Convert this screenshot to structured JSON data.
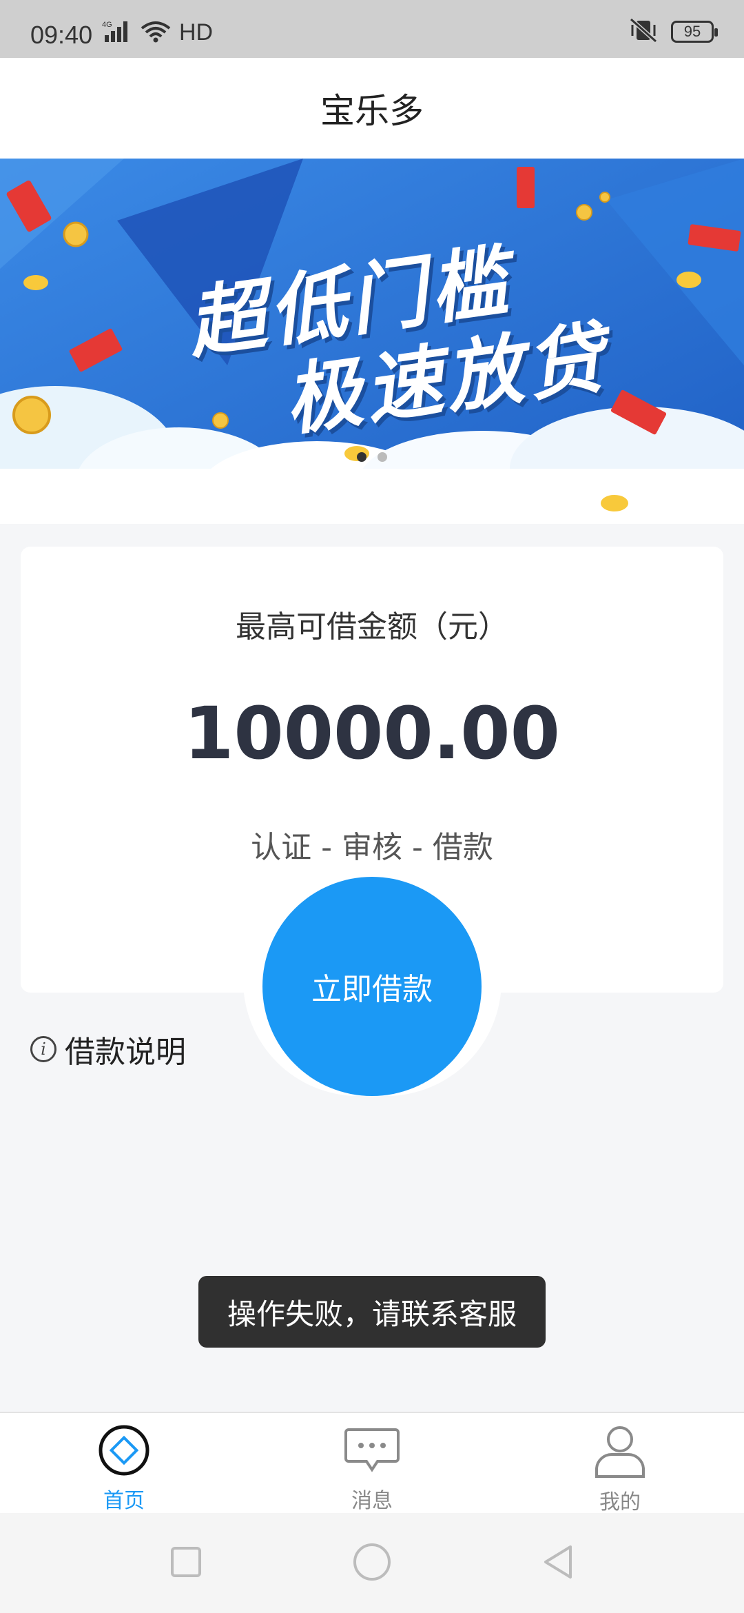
{
  "status_bar": {
    "time": "09:40",
    "network": "4G",
    "hd": "HD",
    "battery": "95"
  },
  "header": {
    "title": "宝乐多"
  },
  "banner": {
    "line1": "超低门槛",
    "line2": "极速放贷",
    "slide_count": 2,
    "active_slide": 1
  },
  "loan_card": {
    "label": "最高可借金额（元）",
    "amount": "10000.00",
    "steps": "认证 - 审核 - 借款"
  },
  "loan_button": {
    "label": "立即借款"
  },
  "loan_info": {
    "label": "借款说明"
  },
  "toast": {
    "message": "操作失败，请联系客服"
  },
  "tabs": [
    {
      "label": "首页",
      "icon": "home-diamond-icon",
      "active": true
    },
    {
      "label": "消息",
      "icon": "message-bubble-icon",
      "active": false
    },
    {
      "label": "我的",
      "icon": "profile-person-icon",
      "active": false
    }
  ],
  "colors": {
    "accent": "#1b99f5",
    "amount": "#2e3342",
    "banner_bg": "#2a74d6",
    "toast_bg": "#303030"
  }
}
